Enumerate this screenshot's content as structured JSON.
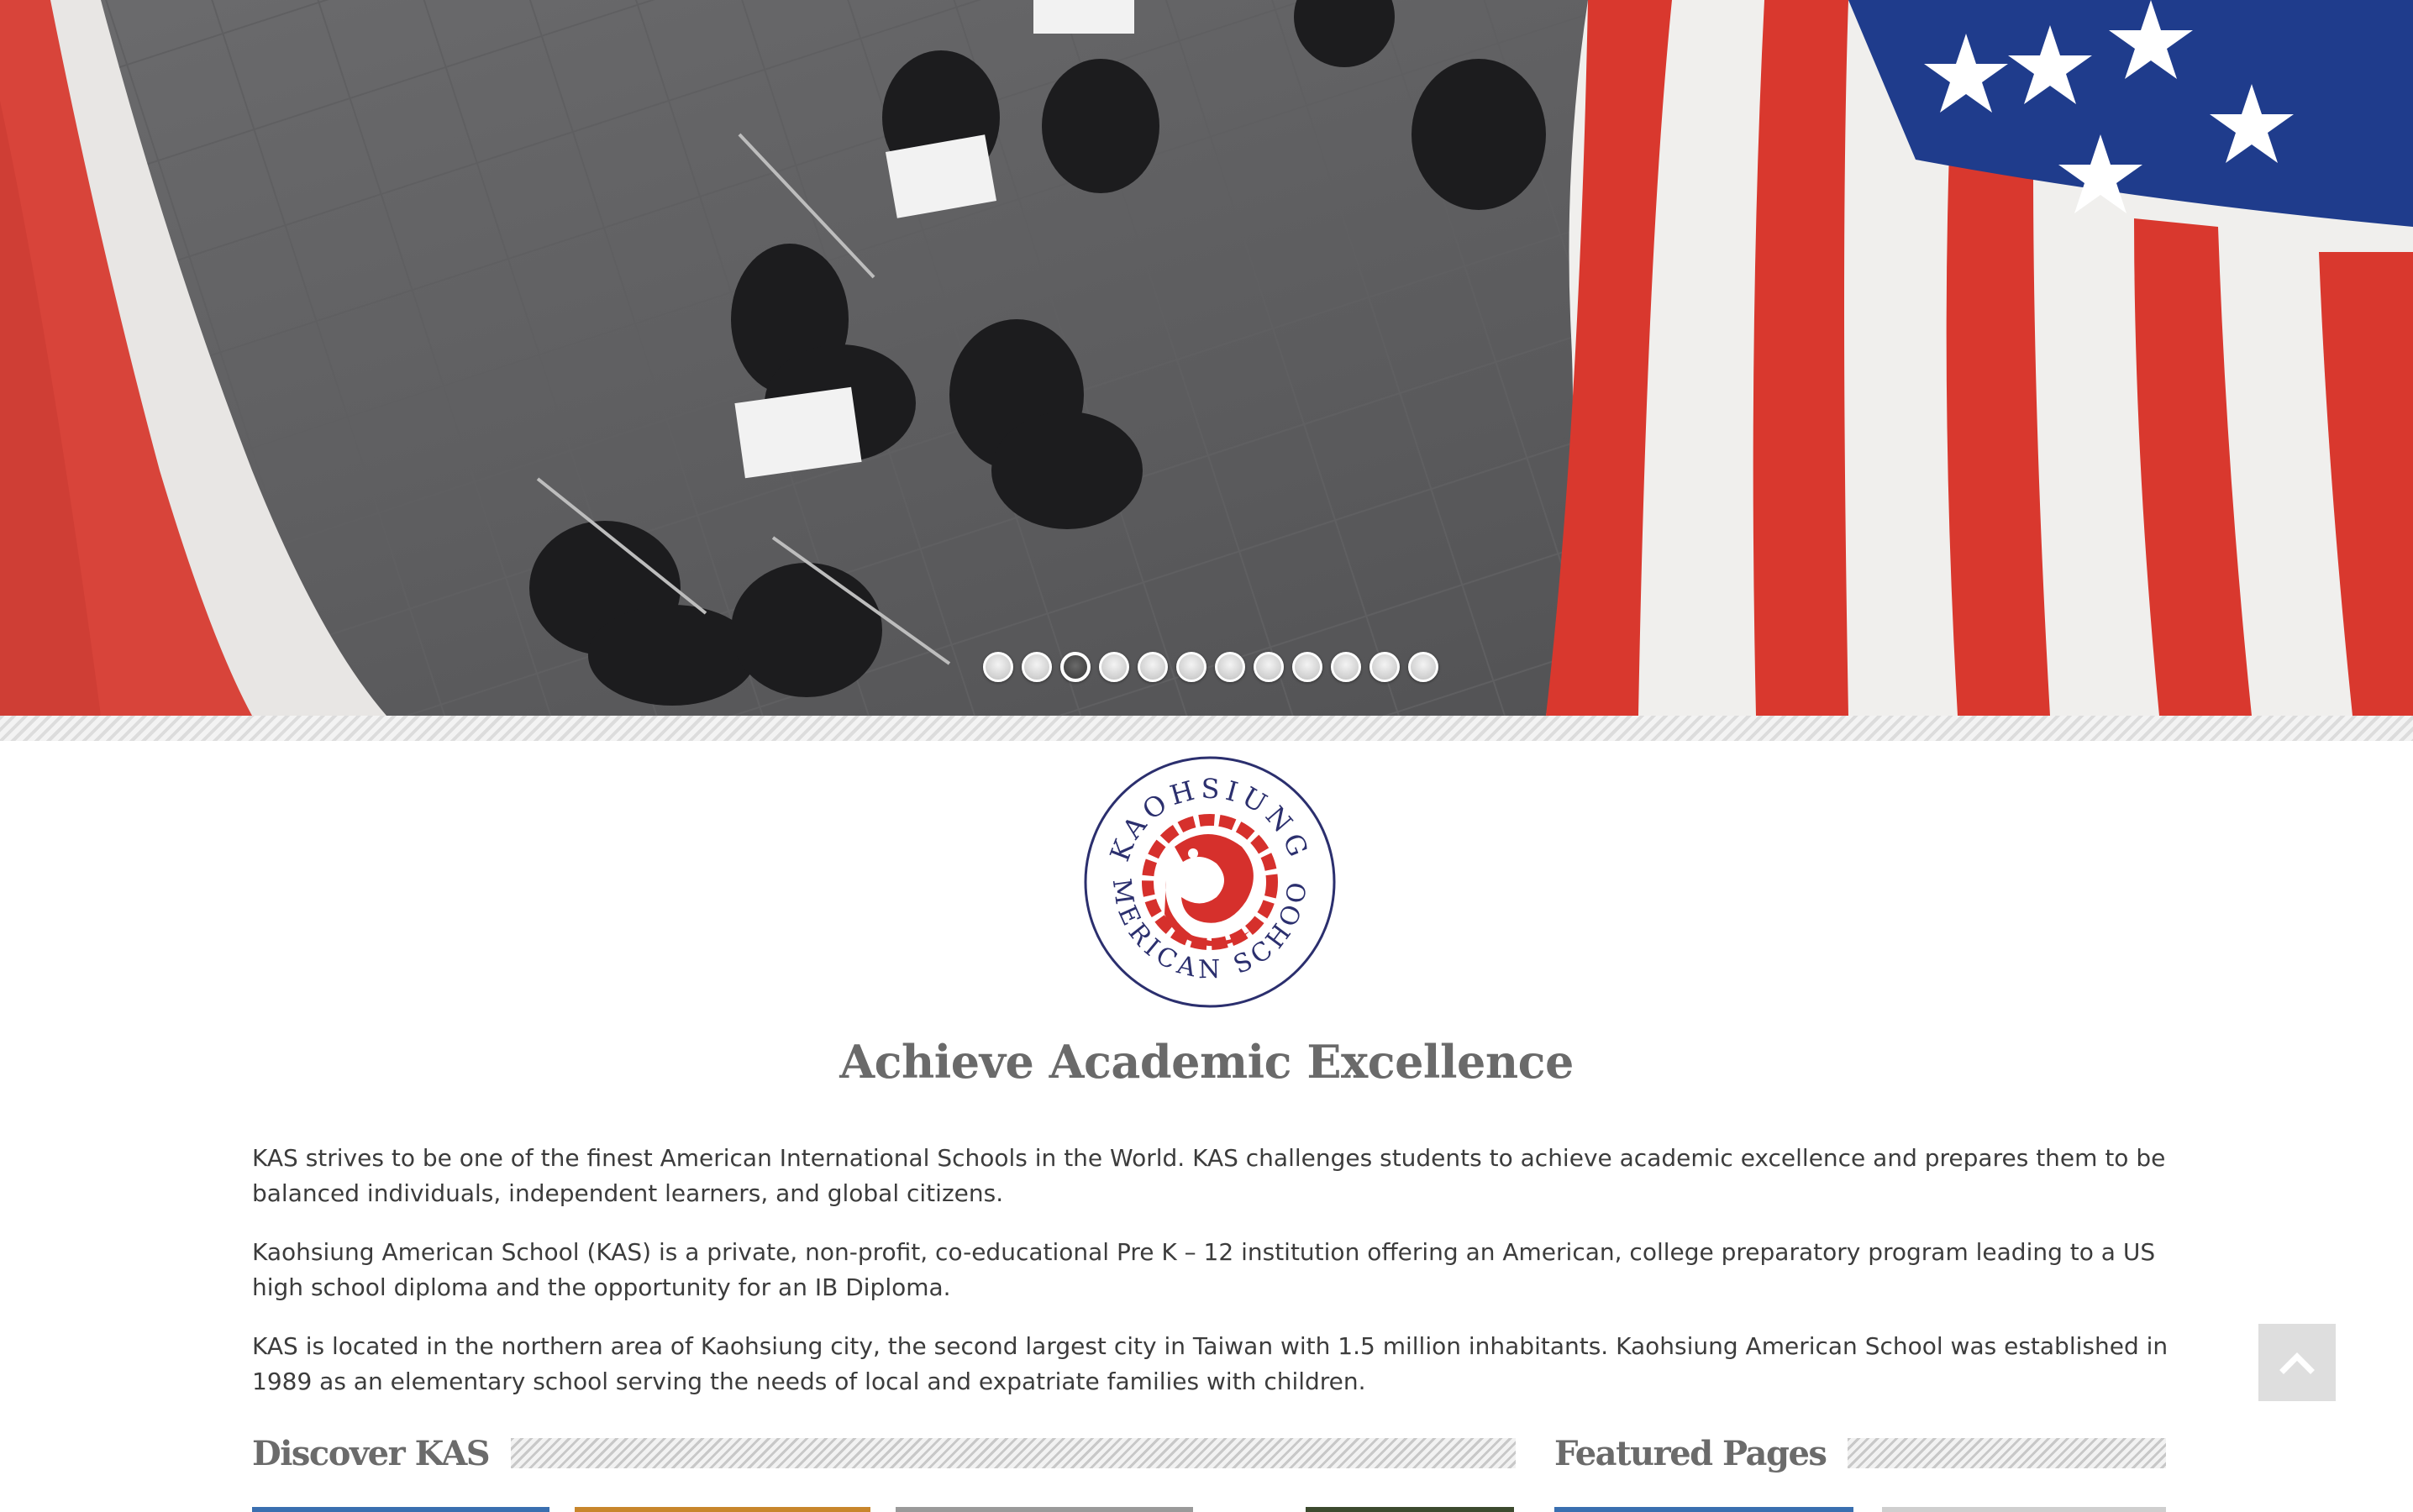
{
  "hero": {
    "slide_count": 12,
    "active_slide": 3,
    "image_description_icon": "orchestra-photo"
  },
  "logo": {
    "top_text": "KAOHSIUNG",
    "bottom_text": "AMERICAN SCHOOL",
    "ring_color": "#2b2f6e",
    "dragon_color": "#d6302c"
  },
  "main": {
    "title": "Achieve Academic Excellence",
    "paragraphs": [
      "KAS strives to be one of the finest American International Schools in the World. KAS challenges students to achieve academic excellence and prepares them to be balanced individuals, independent learners, and global citizens.",
      "Kaohsiung American School (KAS) is a private, non-profit, co-educational Pre K – 12 institution offering an American, college preparatory program leading to a US high school diploma and the opportunity for an IB Diploma.",
      "KAS is located in the northern area of Kaohsiung city, the second largest city  in Taiwan with 1.5 million inhabitants. Kaohsiung American School was established in 1989 as an elementary school serving the needs of local and expatriate families with children."
    ]
  },
  "sections": {
    "discover_title": "Discover KAS",
    "featured_title": "Featured Pages"
  },
  "colors": {
    "text": "#3c3c3c",
    "heading": "#6a6a6a",
    "accent_blue": "#3a6fb0",
    "back_to_top_bg": "#dedede"
  },
  "back_to_top_icon": "chevron-up-icon"
}
